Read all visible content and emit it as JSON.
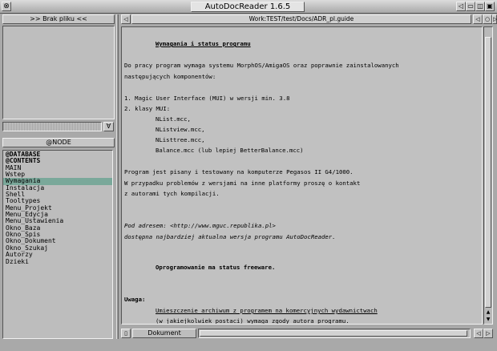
{
  "window": {
    "title": "AutoDocReader 1.6.5",
    "close_glyph": "⊗",
    "buttons": [
      "◁",
      "▭",
      "◫",
      "▣"
    ]
  },
  "left": {
    "file_button": ">> Brak pliku <<",
    "text_field": "",
    "pick_glyph": "Ɐ",
    "node_button": "@NODE",
    "nodes": [
      "@DATABASE",
      "@CONTENTS",
      "MAIN",
      "Wstep",
      "Wymagania",
      "Instalacja",
      "Shell",
      "Tooltypes",
      "Menu_Projekt",
      "Menu_Edycja",
      "Menu_Ustawienia",
      "Okno_Baza",
      "Okno_Spis",
      "Okno_Dokument",
      "Okno_Szukaj",
      "Autorzy",
      "Dzieki"
    ],
    "selected_node": "Wymagania"
  },
  "right": {
    "path": "Work:TEST/test/Docs/ADR_pl.guide",
    "nav_buttons": [
      "◁",
      "○",
      "▷"
    ],
    "doc": {
      "heading": "Wymagania i status programu",
      "intro": [
        "Do pracy program wymaga systemu MorphOS/AmigaOS oraz poprawnie zainstalowanych",
        "następujących komponentów:"
      ],
      "requirements": [
        "1. Magic User Interface (MUI) w wersji min. 3.8",
        "2. klasy MUI:"
      ],
      "mui_classes": [
        "NList.mcc,",
        "NListview.mcc,",
        "NListtree.mcc,",
        "Balance.mcc (lub lepiej BetterBalance.mcc)"
      ],
      "tested": [
        "Program jest pisany i testowany na komputerze Pegasos II G4/1000.",
        "W przypadku problemów z wersjami na inne platformy proszę o kontakt",
        "z autorami tych kompilacji."
      ],
      "address": [
        "Pod adresem: <http://www.mguc.republika.pl>",
        "dostępna najbardziej aktualna wersja programu AutoDocReader."
      ],
      "freeware": "Oprogramowanie ma status freeware.",
      "note_label": "Uwaga:",
      "note_lines": [
        "Umieszczenie archiwum z programem na komercyjnych wydawnictwach",
        "(w jakiejkolwiek postaci) wymaga zgody autora programu."
      ]
    },
    "tab_label": "Dokument",
    "tab_icon": "▯",
    "scroll_arrows": [
      "▲",
      "▼",
      "◁",
      "▷"
    ]
  }
}
